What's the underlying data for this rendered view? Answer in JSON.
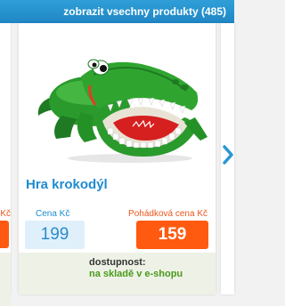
{
  "topbar": {
    "link_label": "zobrazit vsechny produkty (485)"
  },
  "left_partial_card": {
    "price_label_fragment": "Kč"
  },
  "product": {
    "title": "Hra krokodýl",
    "price_label": "Cena Kč",
    "price": "199",
    "fairy_price_label": "Pohádková cena Kč",
    "fairy_price": "159",
    "availability_label": "dostupnost:",
    "availability_value": "na skladě v e-shopu"
  },
  "icons": {
    "next": "chevron-right-icon"
  },
  "colors": {
    "brand_blue": "#1d8bd0",
    "topbar": "#2a97d3",
    "fairy_orange": "#ff5a10",
    "stock_green": "#4a9a1e"
  }
}
